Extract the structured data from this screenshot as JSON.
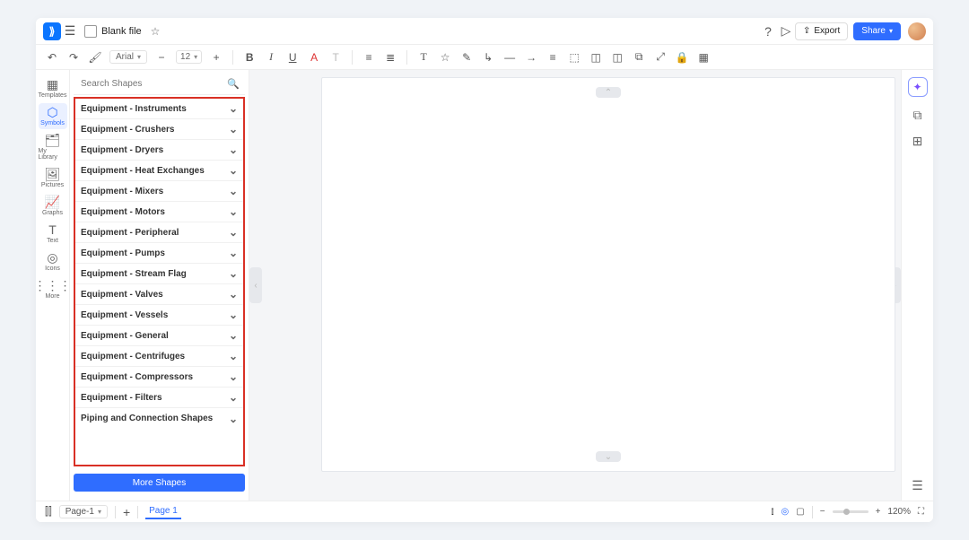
{
  "header": {
    "title": "Blank file",
    "export_label": "Export",
    "share_label": "Share"
  },
  "toolbar": {
    "font": "Arial",
    "size": "12"
  },
  "rail": [
    {
      "icon": "▦",
      "label": "Templates"
    },
    {
      "icon": "⬡",
      "label": "Symbols"
    },
    {
      "icon": "🗂",
      "label": "My Library"
    },
    {
      "icon": "🖼",
      "label": "Pictures"
    },
    {
      "icon": "📈",
      "label": "Graphs"
    },
    {
      "icon": "T",
      "label": "Text"
    },
    {
      "icon": "◎",
      "label": "Icons"
    },
    {
      "icon": "⋮⋮⋮",
      "label": "More"
    }
  ],
  "rail_active_index": 1,
  "search": {
    "placeholder": "Search Shapes"
  },
  "categories": [
    "Equipment - Instruments",
    "Equipment - Crushers",
    "Equipment - Dryers",
    "Equipment - Heat Exchanges",
    "Equipment - Mixers",
    "Equipment - Motors",
    "Equipment - Peripheral",
    "Equipment - Pumps",
    "Equipment - Stream Flag",
    "Equipment - Valves",
    "Equipment - Vessels",
    "Equipment - General",
    "Equipment - Centrifuges",
    "Equipment - Compressors",
    "Equipment - Filters",
    "Piping and Connection Shapes"
  ],
  "more_shapes": "More Shapes",
  "status": {
    "page_select": "Page-1",
    "active_page": "Page 1",
    "zoom": "120%"
  }
}
